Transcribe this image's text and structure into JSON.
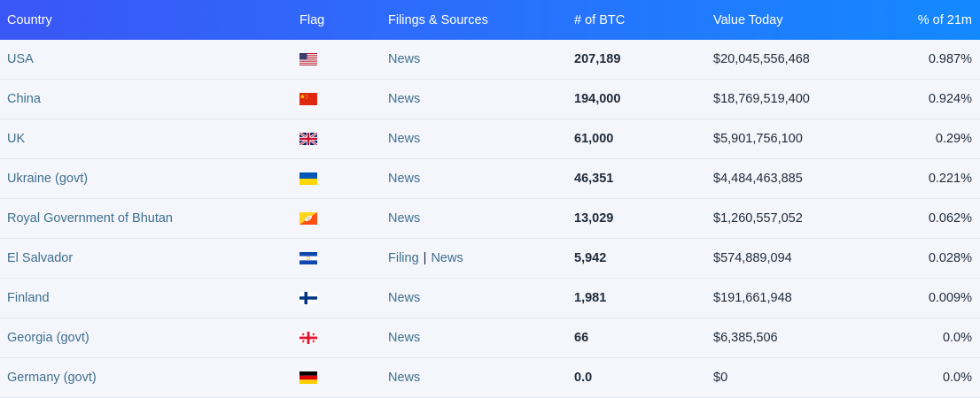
{
  "headers": {
    "country": "Country",
    "flag": "Flag",
    "sources": "Filings & Sources",
    "btc": "# of BTC",
    "value": "Value Today",
    "pct": "% of 21m"
  },
  "rows": [
    {
      "country": "USA",
      "flag_icon": "us-flag-icon",
      "links": [
        "News"
      ],
      "btc": "207,189",
      "value": "$20,045,556,468",
      "pct": "0.987%"
    },
    {
      "country": "China",
      "flag_icon": "china-flag-icon",
      "links": [
        "News"
      ],
      "btc": "194,000",
      "value": "$18,769,519,400",
      "pct": "0.924%"
    },
    {
      "country": "UK",
      "flag_icon": "uk-flag-icon",
      "links": [
        "News"
      ],
      "btc": "61,000",
      "value": "$5,901,756,100",
      "pct": "0.29%"
    },
    {
      "country": "Ukraine (govt)",
      "flag_icon": "ukraine-flag-icon",
      "links": [
        "News"
      ],
      "btc": "46,351",
      "value": "$4,484,463,885",
      "pct": "0.221%"
    },
    {
      "country": "Royal Government of Bhutan",
      "flag_icon": "bhutan-flag-icon",
      "links": [
        "News"
      ],
      "btc": "13,029",
      "value": "$1,260,557,052",
      "pct": "0.062%"
    },
    {
      "country": "El Salvador",
      "flag_icon": "el-salvador-flag-icon",
      "links": [
        "Filing",
        "News"
      ],
      "separator": "|",
      "btc": "5,942",
      "value": "$574,889,094",
      "pct": "0.028%"
    },
    {
      "country": "Finland",
      "flag_icon": "finland-flag-icon",
      "links": [
        "News"
      ],
      "btc": "1,981",
      "value": "$191,661,948",
      "pct": "0.009%"
    },
    {
      "country": "Georgia (govt)",
      "flag_icon": "georgia-flag-icon",
      "links": [
        "News"
      ],
      "btc": "66",
      "value": "$6,385,506",
      "pct": "0.0%"
    },
    {
      "country": "Germany (govt)",
      "flag_icon": "germany-flag-icon",
      "links": [
        "News"
      ],
      "btc": "0.0",
      "value": "$0",
      "pct": "0.0%"
    }
  ],
  "colors": {
    "header_gradient_start": "#3a56f5",
    "header_gradient_end": "#1389ff",
    "link": "#3f6f8e",
    "row_background": "#f4f6fb"
  }
}
